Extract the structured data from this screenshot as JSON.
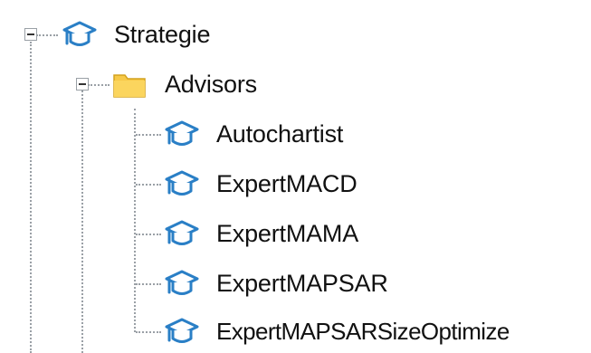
{
  "tree": {
    "root": {
      "label": "Strategie",
      "icon": "graduation-cap-icon",
      "expanded": true
    },
    "folder": {
      "label": "Advisors",
      "icon": "folder-icon",
      "expanded": true
    },
    "items": [
      {
        "label": "Autochartist",
        "icon": "graduation-cap-icon"
      },
      {
        "label": "ExpertMACD",
        "icon": "graduation-cap-icon"
      },
      {
        "label": "ExpertMAMA",
        "icon": "graduation-cap-icon"
      },
      {
        "label": "ExpertMAPSAR",
        "icon": "graduation-cap-icon"
      },
      {
        "label": "ExpertMAPSARSizeOptimize",
        "icon": "graduation-cap-icon"
      }
    ]
  },
  "colors": {
    "cap_blue": "#2a7fc6",
    "folder_yellow": "#f7c948",
    "tree_line": "#9aa0a6"
  }
}
